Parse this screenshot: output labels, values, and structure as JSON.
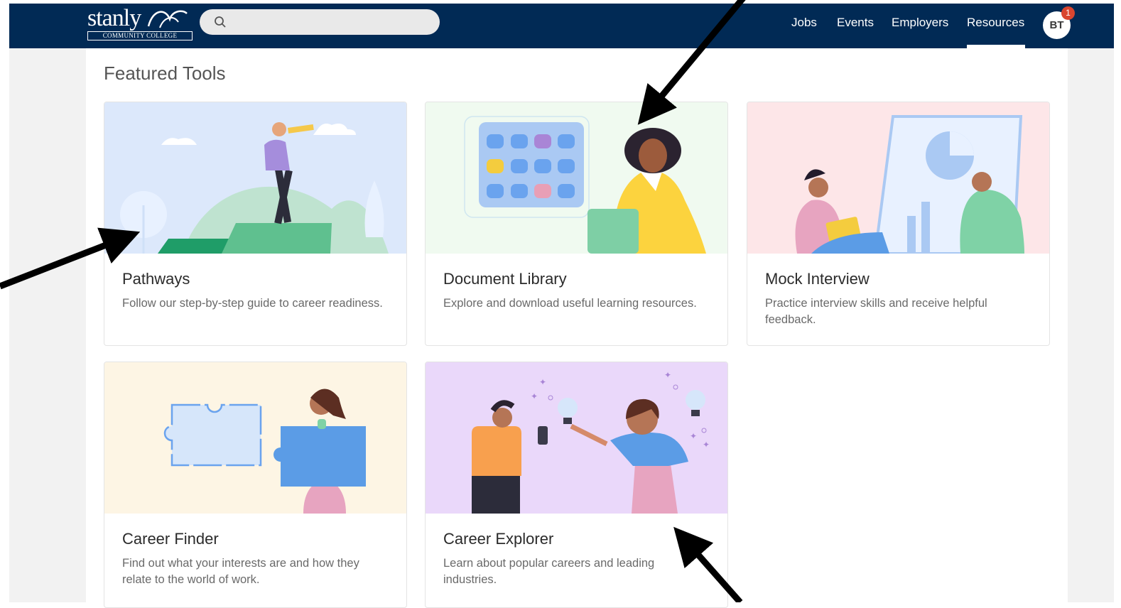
{
  "navbar": {
    "logo_word": "stanly",
    "logo_sub": "COMMUNITY COLLEGE",
    "search_placeholder": "",
    "links": [
      "Jobs",
      "Events",
      "Employers",
      "Resources"
    ],
    "active_link": "Resources",
    "avatar_initials": "BT",
    "notification_count": "1"
  },
  "section": {
    "title": "Featured Tools"
  },
  "cards": [
    {
      "title": "Pathways",
      "description": "Follow our step-by-step guide to career readiness.",
      "bg": "#dce8fb"
    },
    {
      "title": "Document Library",
      "description": "Explore and download useful learning resources.",
      "bg": "#eefaee"
    },
    {
      "title": "Mock Interview",
      "description": "Practice interview skills and receive helpful feedback.",
      "bg": "#fde6e8"
    },
    {
      "title": "Career Finder",
      "description": "Find out what your interests are and how they relate to the world of work.",
      "bg": "#fdf5e4"
    },
    {
      "title": "Career Explorer",
      "description": "Learn about popular careers and leading industries.",
      "bg": "#ead8fa"
    }
  ],
  "colors": {
    "navbar": "#012a55",
    "accent_badge": "#d9452f"
  }
}
